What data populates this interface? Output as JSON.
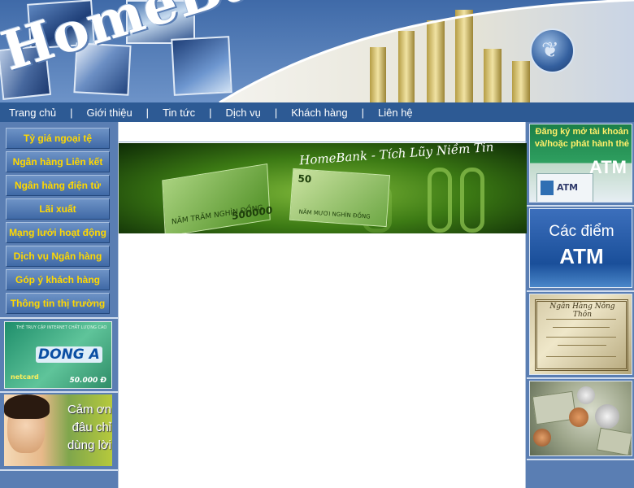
{
  "header": {
    "logo_text": "HomeBank.com",
    "globe_symbol": "❦"
  },
  "nav": {
    "items": [
      {
        "label": "Trang chủ"
      },
      {
        "label": "Giới thiệu"
      },
      {
        "label": "Tin tức"
      },
      {
        "label": "Dịch vụ"
      },
      {
        "label": "Khách hàng"
      },
      {
        "label": "Liên hệ"
      }
    ],
    "separator": "|"
  },
  "sidebar": {
    "menu": [
      {
        "label": "Tỷ giá ngoại tệ"
      },
      {
        "label": "Ngân hàng Liên kết"
      },
      {
        "label": "Ngân hàng điện tử"
      },
      {
        "label": "Lãi xuất"
      },
      {
        "label": "Mạng lưới hoạt động"
      },
      {
        "label": "Dịch vụ Ngân hàng"
      },
      {
        "label": "Góp ý khách hàng"
      },
      {
        "label": "Thông tin thị trường"
      }
    ],
    "donga_card": {
      "small_text": "THẺ TRUY CẬP INTERNET CHẤT LƯỢNG CAO",
      "brand": "DONG A",
      "provider": "netcard",
      "price": "50.000 Đ"
    },
    "thanks_card": {
      "lines": [
        "Cảm ơn",
        "đâu chỉ",
        "dùng lời"
      ]
    }
  },
  "banner": {
    "title": "HomeBank - Tích Lũy Niềm Tin",
    "note1_text": "NĂM TRĂM NGHÌN ĐỒNG",
    "note1_value": "500000",
    "note2_value": "50",
    "note2_text": "NĂM MƯƠI NGHÌN ĐỒNG"
  },
  "right_ads": {
    "register": {
      "text": "Đăng ký mở tài khoản và/hoặc phát hành thẻ",
      "atm_label": "ATM",
      "machine_label": "ATM"
    },
    "atm_points": {
      "line1": "Các điểm",
      "line2": "ATM"
    },
    "certificate": {
      "heading": "Ngân Hàng Nông Thôn"
    }
  },
  "colors": {
    "page_bg": "#5a7eb3",
    "navbar_bg": "#2d5a94",
    "menu_text": "#ffd800",
    "banner_green": "#3c7a14"
  }
}
